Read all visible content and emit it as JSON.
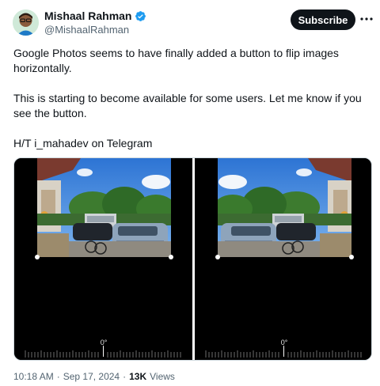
{
  "author": {
    "display_name": "Mishaal Rahman",
    "handle": "@MishaalRahman",
    "verified_color": "#1d9bf0"
  },
  "actions": {
    "subscribe_label": "Subscribe",
    "more_icon": "more-horizontal-icon"
  },
  "tweet": {
    "paragraphs": [
      "Google Photos seems to have finally added a button to flip images horizontally.",
      "This is starting to become available for some users. Let me know if you see the button.",
      "H/T i_mahadev on Telegram"
    ]
  },
  "media": {
    "left_angle": "0°",
    "right_angle": "0°"
  },
  "meta": {
    "time": "10:18 AM",
    "separator": "·",
    "date": "Sep 17, 2024",
    "separator2": "·",
    "views_count": "13K",
    "views_label": "Views"
  }
}
